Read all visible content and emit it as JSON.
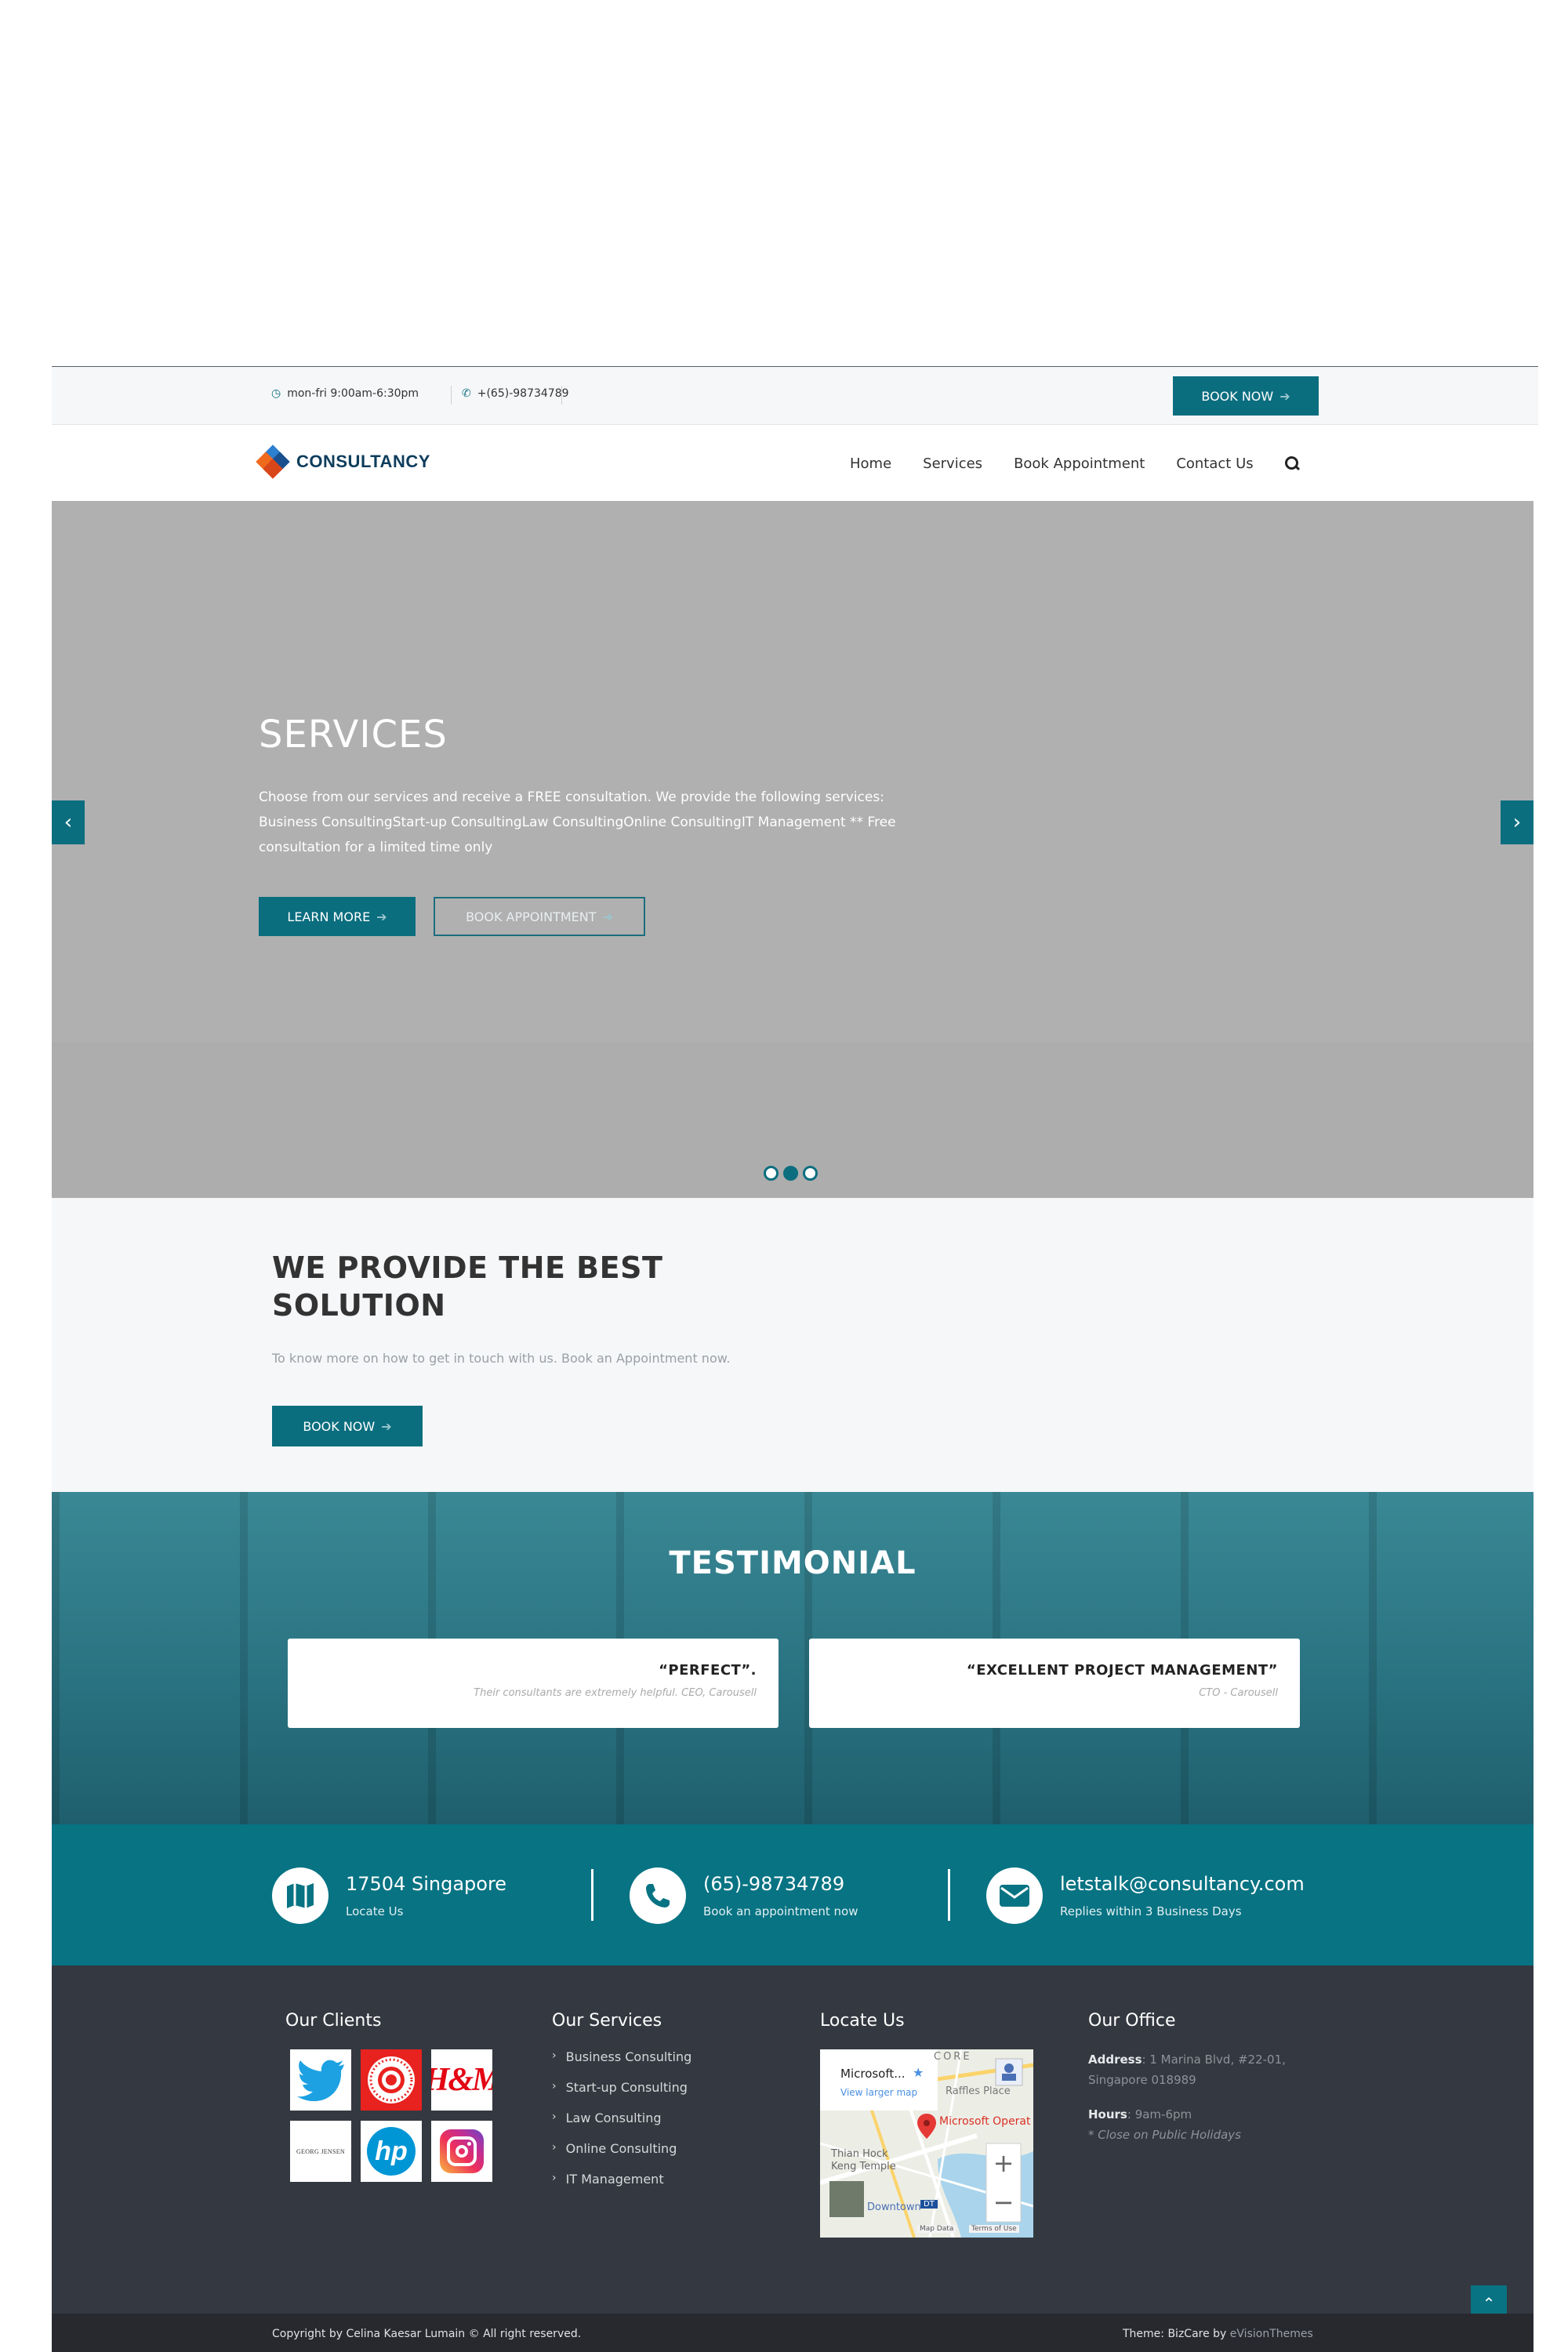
{
  "topbar": {
    "hours": "mon-fri 9:00am-6:30pm",
    "phone": "+(65)-98734789",
    "book_label": "BOOK NOW"
  },
  "header": {
    "logo_text": "CONSULTANCY",
    "nav": [
      "Home",
      "Services",
      "Book Appointment",
      "Contact Us"
    ]
  },
  "hero": {
    "title": "SERVICES",
    "description": "Choose from our services and receive a FREE consultation. We provide the following services: Business ConsultingStart-up ConsultingLaw ConsultingOnline ConsultingIT Management ** Free consultation for a limited time only",
    "learn_more": "LEARN MORE",
    "book_appointment": "BOOK APPOINTMENT",
    "slide_count": 3,
    "active_slide": 2
  },
  "solution": {
    "title": "WE PROVIDE THE BEST SOLUTION",
    "text": "To know more on how to get in touch with us. Book an Appointment now.",
    "button": "BOOK NOW"
  },
  "testimonial": {
    "title": "TESTIMONIAL",
    "cards": [
      {
        "quote": "“PERFECT”.",
        "author": "Their consultants are extremely helpful. CEO, Carousell"
      },
      {
        "quote": "“EXCELLENT PROJECT MANAGEMENT”",
        "author": "CTO - Carousell"
      }
    ]
  },
  "contact": {
    "location_title": "17504 Singapore",
    "location_sub": "Locate Us",
    "phone_title": "(65)-98734789",
    "phone_sub": "Book an appointment now",
    "email_title": "letstalk@consultancy.com",
    "email_sub": "Replies within 3 Business Days"
  },
  "footer": {
    "clients_title": "Our Clients",
    "clients": [
      "twitter",
      "target",
      "H&M",
      "GEORG JENSEN",
      "hp",
      "instagram"
    ],
    "client_labels": {
      "hm": "H&M",
      "georg": "GEORG JENSEN",
      "hp": "hp"
    },
    "services_title": "Our Services",
    "services": [
      "Business Consulting",
      "Start-up Consulting",
      "Law Consulting",
      "Online Consulting",
      "IT Management"
    ],
    "locate_title": "Locate Us",
    "map": {
      "place": "Microsoft...",
      "larger": "View larger map",
      "label": "Microsoft Operat",
      "area1": "Raffles Place",
      "area2": "Thian Hock",
      "area3": "Keng Temple",
      "area4": "Downtown",
      "core": "CORE",
      "badge": "DT",
      "map_data": "Map Data",
      "terms": "Terms of Use"
    },
    "office_title": "Our Office",
    "address_label": "Address",
    "address": ": 1 Marina Blvd, #22-01, Singapore 018989",
    "hours_label": "Hours",
    "hours": ": 9am-6pm",
    "note": "* Close on Public Holidays"
  },
  "bottom": {
    "copyright": "Copyright by Celina Kaesar Lumain © All right reserved.",
    "theme_prefix": "Theme: BizCare by ",
    "theme_author": "eVisionThemes"
  },
  "colors": {
    "brand": "#0b6e7f",
    "footer_bg": "#343840",
    "hero_bg": "#b0b0b0"
  }
}
